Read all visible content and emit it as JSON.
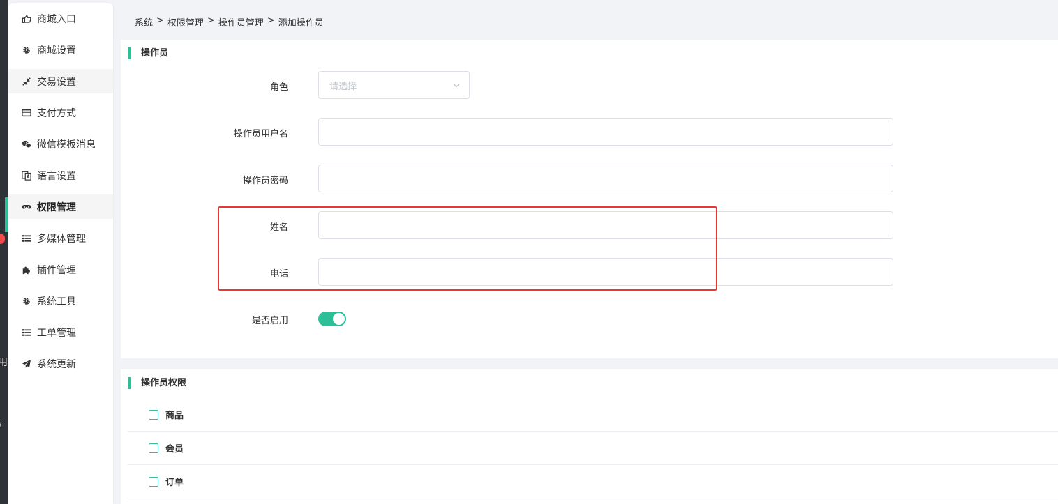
{
  "edge": {
    "char1": "用",
    "char2": "/"
  },
  "sidebar": {
    "items": [
      {
        "label": "商城入口",
        "icon": "hand-point-icon"
      },
      {
        "label": "商城设置",
        "icon": "gear-icon"
      },
      {
        "label": "交易设置",
        "icon": "compress-icon"
      },
      {
        "label": "支付方式",
        "icon": "credit-card-icon"
      },
      {
        "label": "微信模板消息",
        "icon": "wechat-icon"
      },
      {
        "label": "语言设置",
        "icon": "language-icon"
      },
      {
        "label": "权限管理",
        "icon": "mask-icon"
      },
      {
        "label": "多媒体管理",
        "icon": "list-icon"
      },
      {
        "label": "插件管理",
        "icon": "puzzle-icon"
      },
      {
        "label": "系统工具",
        "icon": "gear-icon"
      },
      {
        "label": "工单管理",
        "icon": "list-icon"
      },
      {
        "label": "系统更新",
        "icon": "paper-plane-icon"
      }
    ],
    "active_label": "权限管理",
    "hover_label": "交易设置"
  },
  "breadcrumb": {
    "items": [
      "系统",
      "权限管理",
      "操作员管理",
      "添加操作员"
    ],
    "separator": ">"
  },
  "operator_section": {
    "title": "操作员",
    "role": {
      "label": "角色",
      "placeholder": "请选择"
    },
    "username": {
      "label": "操作员用户名",
      "value": ""
    },
    "password": {
      "label": "操作员密码",
      "value": ""
    },
    "name": {
      "label": "姓名",
      "value": ""
    },
    "phone": {
      "label": "电话",
      "value": ""
    },
    "enabled": {
      "label": "是否启用",
      "on": true
    }
  },
  "permission_section": {
    "title": "操作员权限",
    "items": [
      {
        "label": "商品",
        "checked": false
      },
      {
        "label": "会员",
        "checked": false
      },
      {
        "label": "订单",
        "checked": false
      }
    ]
  },
  "colors": {
    "accent": "#2dbf97",
    "highlight": "#e8382f"
  }
}
